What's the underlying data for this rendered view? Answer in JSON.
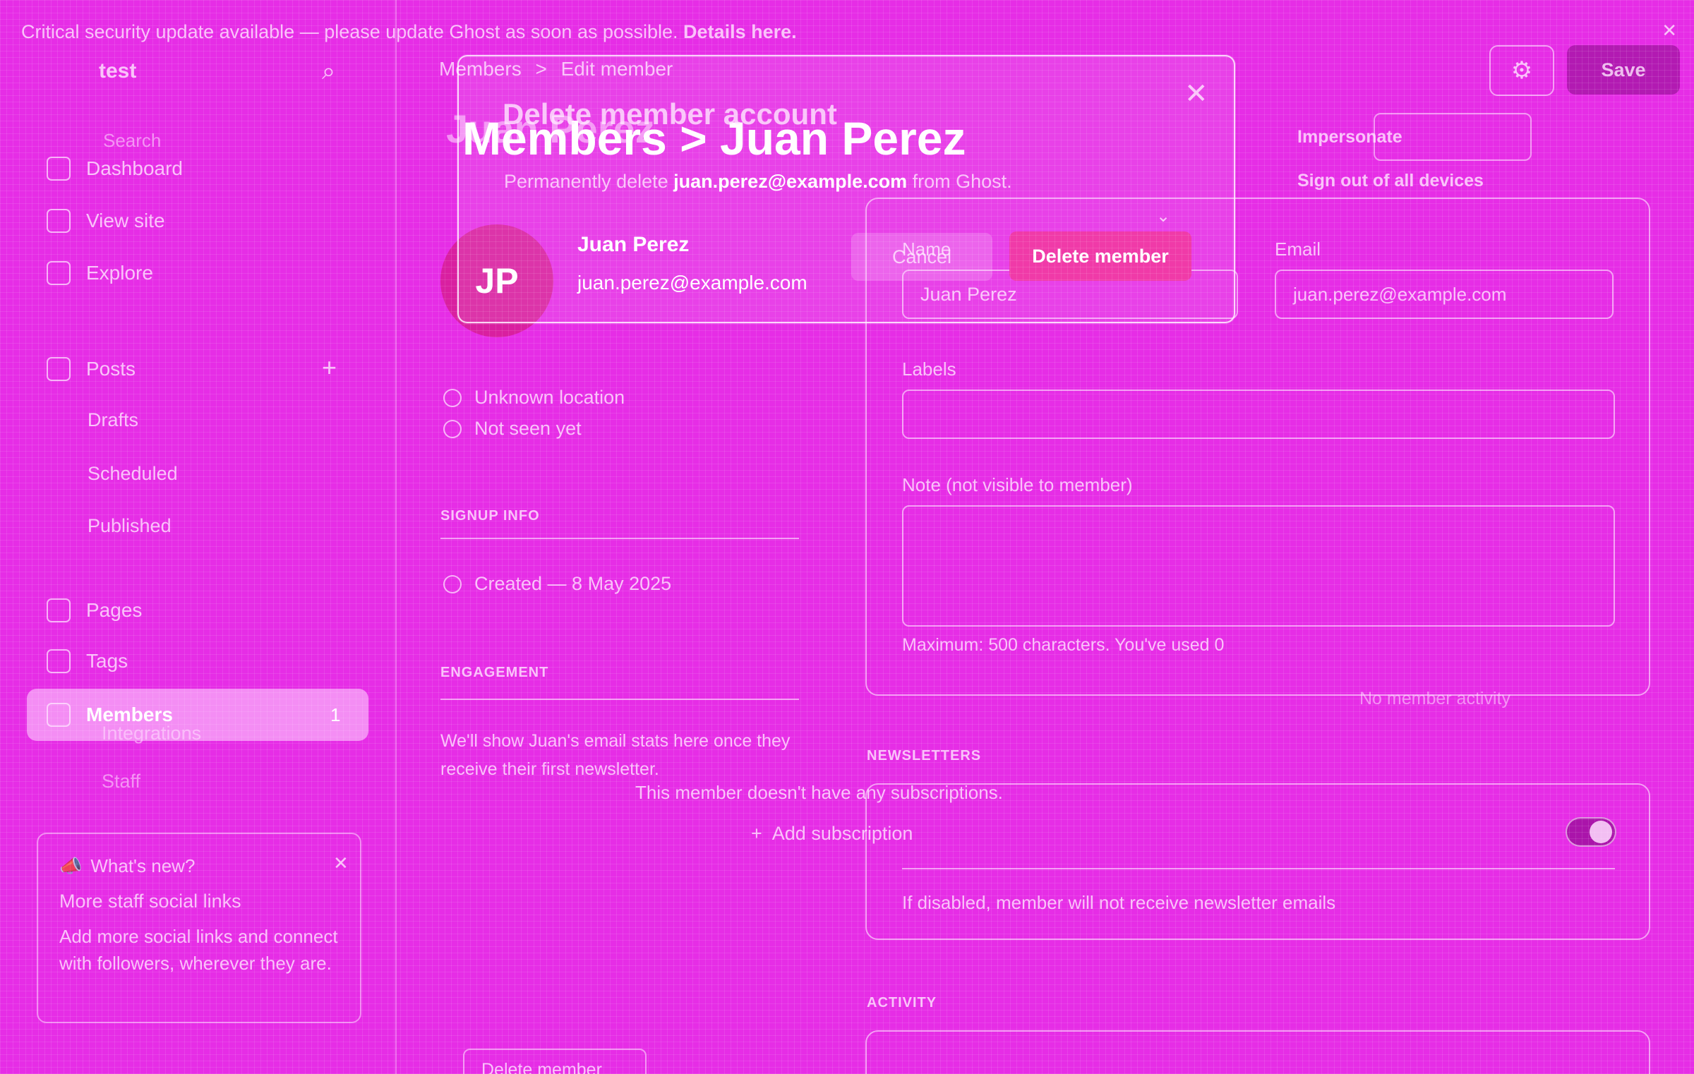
{
  "banner": {
    "text": "Critical security update available — please update Ghost as soon as possible.",
    "link": "Details here."
  },
  "sidebar": {
    "site_name": "test",
    "search_placeholder": "Search",
    "items": [
      {
        "label": "Dashboard"
      },
      {
        "label": "View site"
      },
      {
        "label": "Explore"
      },
      {
        "label": "Posts"
      },
      {
        "label": "Drafts"
      },
      {
        "label": "Scheduled"
      },
      {
        "label": "Published"
      },
      {
        "label": "Pages"
      },
      {
        "label": "Tags"
      },
      {
        "label": "Members",
        "count": "1"
      },
      {
        "label": "Integrations"
      },
      {
        "label": "Staff"
      }
    ],
    "whats_new": {
      "title": "What's new?",
      "headline": "More staff social links",
      "body": "Add more social links and connect with followers, wherever they are."
    }
  },
  "header": {
    "breadcrumb_parent": "Members",
    "breadcrumb_sep": ">",
    "breadcrumb_current": "Edit member",
    "title": "Members > Juan Perez",
    "ghost_title": "Juan Perez",
    "save_label": "Save"
  },
  "profile": {
    "initials": "JP",
    "name": "Juan Perez",
    "email": "juan.perez@example.com",
    "location": "Unknown location",
    "last_seen": "Not seen yet",
    "signup_label": "SIGNUP INFO",
    "created": "Created — 8 May 2025",
    "engagement_label": "ENGAGEMENT",
    "engagement_text": "We'll show Juan's email stats here once they receive their first newsletter."
  },
  "form": {
    "name_label": "Name",
    "name_value": "Juan Perez",
    "email_label": "Email",
    "email_value": "juan.perez@example.com",
    "labels_label": "Labels",
    "note_label": "Note (not visible to member)",
    "note_hint": "Maximum: 500 characters. You've used 0"
  },
  "newsletters": {
    "label": "NEWSLETTERS",
    "hint": "If disabled, member will not receive newsletter emails"
  },
  "subscriptions": {
    "empty": "This member doesn't have any subscriptions.",
    "add_label": "Add subscription"
  },
  "activity": {
    "label": "ACTIVITY",
    "empty": "No member activity"
  },
  "actions": {
    "impersonate": "Impersonate",
    "signout": "Sign out of all devices",
    "delete_member": "Delete member"
  },
  "modal": {
    "title": "Delete member account",
    "desc_prefix": "Permanently delete",
    "desc_email": "juan.perez@example.com",
    "desc_suffix": "from Ghost.",
    "cancel_label": "Cancel",
    "delete_label": "Delete member"
  },
  "colors": {
    "background": "#e62de6",
    "accent": "#f03aa8",
    "avatar": "#d91fa0"
  }
}
